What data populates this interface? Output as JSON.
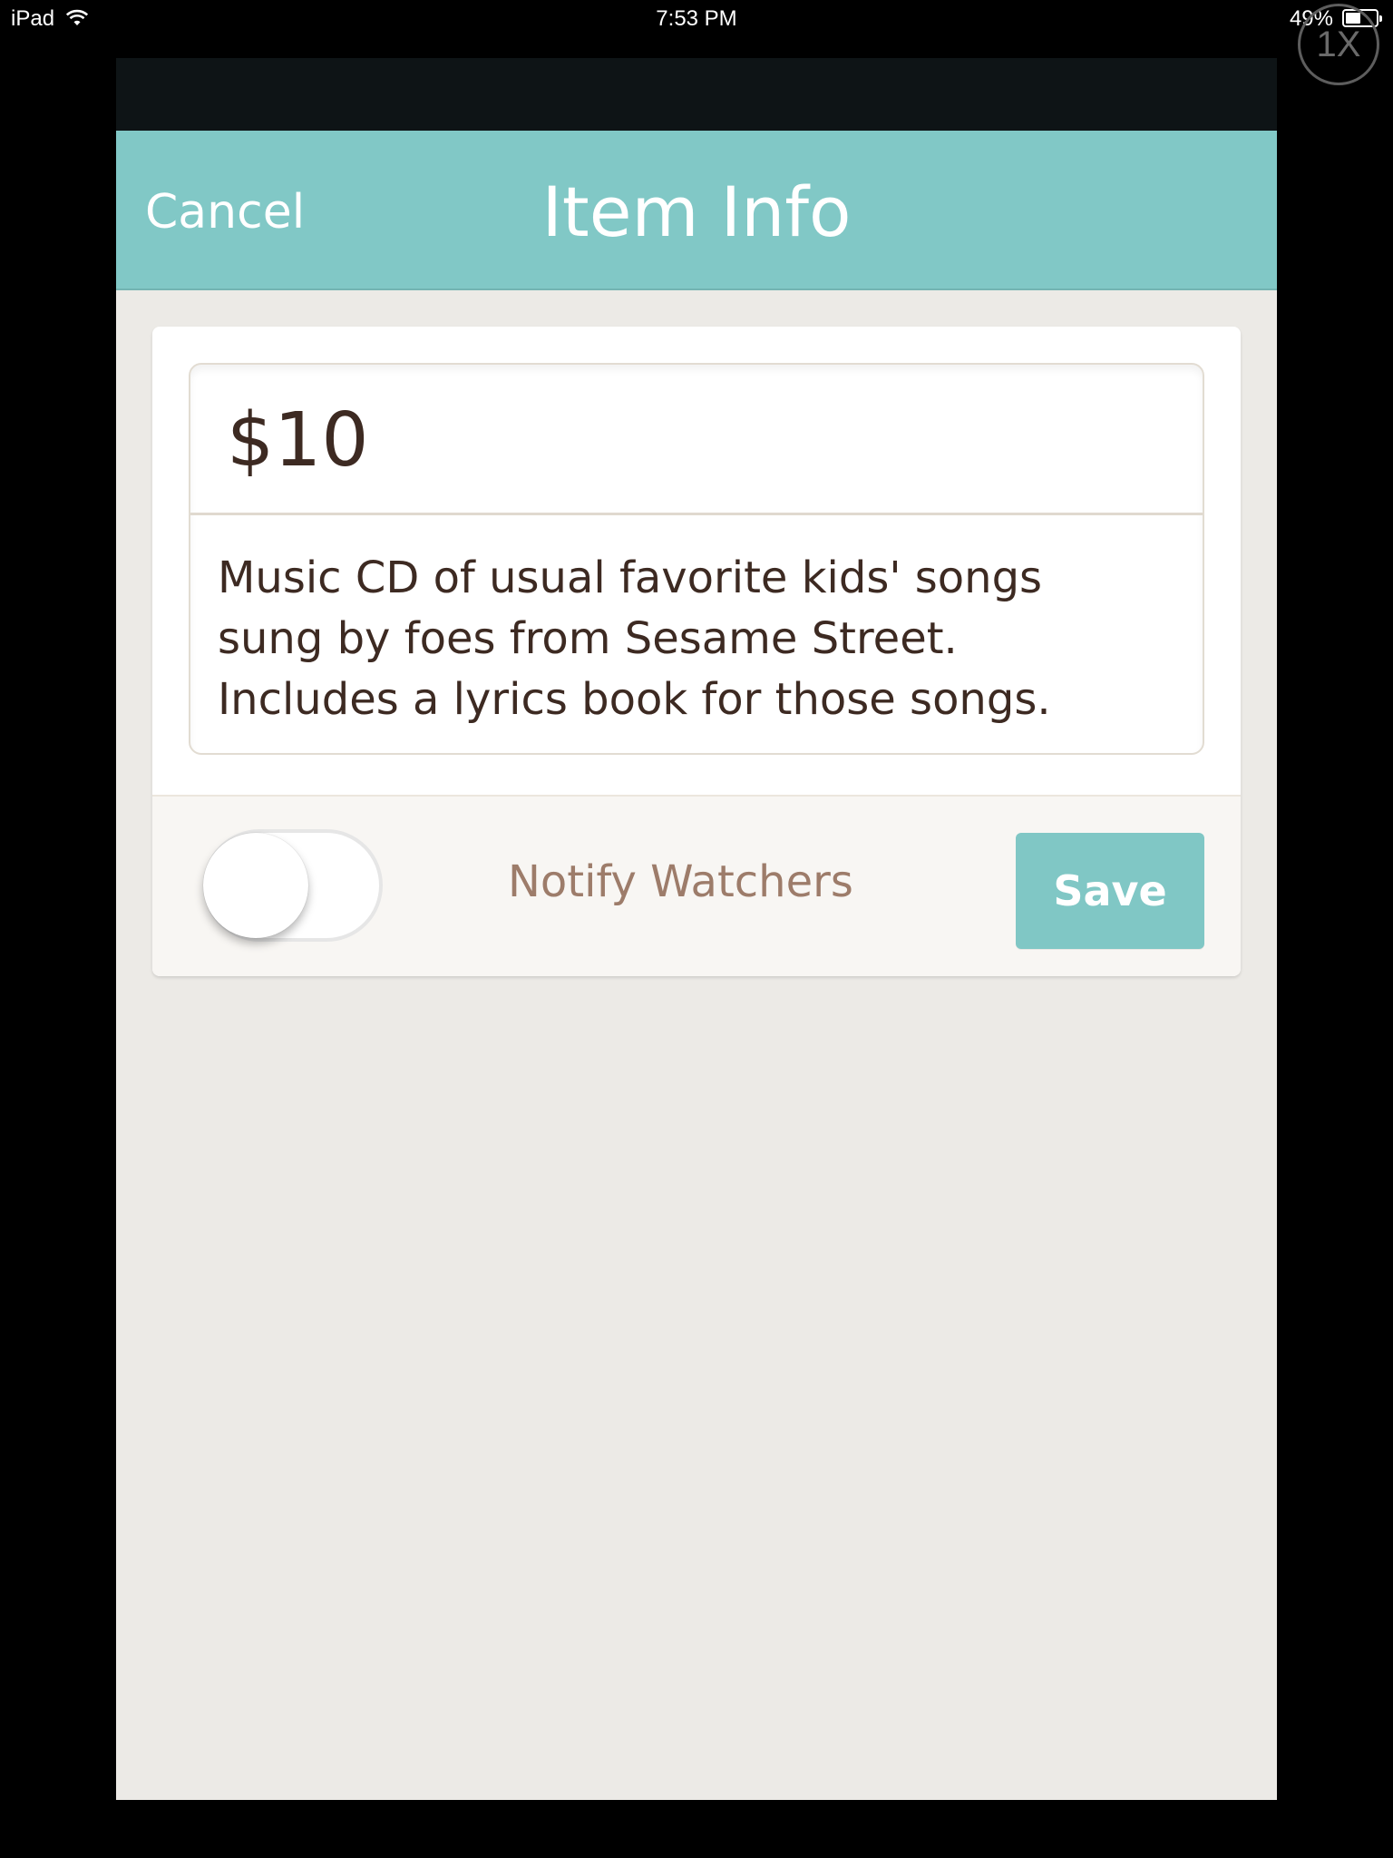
{
  "status_bar": {
    "device": "iPad",
    "time": "7:53 PM",
    "battery": "49%",
    "wifi_icon": "wifi-icon",
    "battery_icon": "battery-icon"
  },
  "zoom_badge": "1X",
  "navbar": {
    "cancel_label": "Cancel",
    "title": "Item Info"
  },
  "item": {
    "price": "$10",
    "description": "Music CD of usual favorite kids' songs\nsung by foes from Sesame Street.\nIncludes a lyrics book for those songs."
  },
  "footer": {
    "notify_toggle_on": false,
    "notify_label": "Notify Watchers",
    "save_label": "Save"
  },
  "colors": {
    "accent": "#81c8c6",
    "text_dark": "#3d2a22",
    "label_brown": "#9d7c6a",
    "background": "#eceae6"
  }
}
